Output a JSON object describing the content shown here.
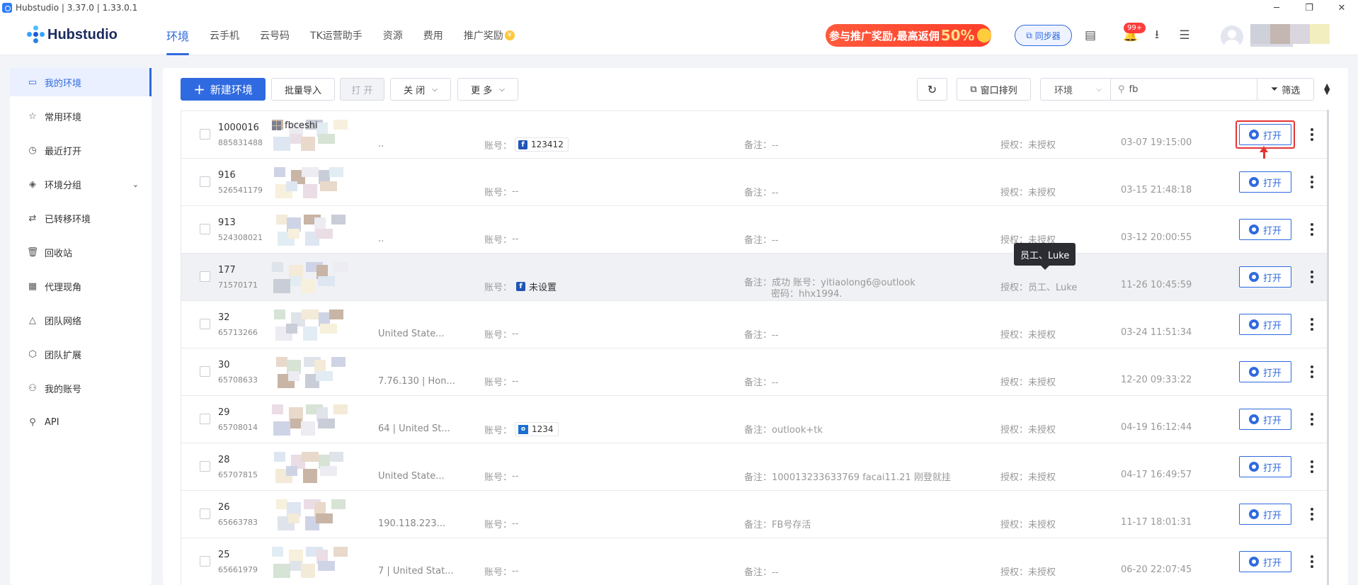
{
  "window": {
    "title": "Hubstudio | 3.37.0 | 1.33.0.1",
    "controls": [
      "─",
      "❐",
      "✕"
    ]
  },
  "header": {
    "brand": "Hubstudio",
    "nav": [
      {
        "label": "环境",
        "active": true
      },
      {
        "label": "云手机"
      },
      {
        "label": "云号码"
      },
      {
        "label": "TK运营助手"
      },
      {
        "label": "资源"
      },
      {
        "label": "费用"
      },
      {
        "label": "推广奖励"
      }
    ],
    "promo_text": "参与推广奖励,最高返佣",
    "promo_percent": "50%",
    "sync_label": "同步器",
    "notification_count": "99+",
    "icons": [
      "sync-window-icon",
      "bell-icon",
      "download-icon",
      "task-list-icon",
      "user-avatar-icon"
    ]
  },
  "sidebar": {
    "items": [
      {
        "label": "我的环境",
        "icon": "monitor-icon",
        "active": true
      },
      {
        "label": "常用环境",
        "icon": "star-icon"
      },
      {
        "label": "最近打开",
        "icon": "clock-icon"
      },
      {
        "label": "环境分组",
        "icon": "layers-icon",
        "expandable": true
      },
      {
        "label": "已转移环境",
        "icon": "transfer-icon"
      },
      {
        "label": "回收站",
        "icon": "trash-icon"
      },
      {
        "label": "代理现角",
        "icon": "proxy-icon"
      },
      {
        "label": "团队网络",
        "icon": "network-icon"
      },
      {
        "label": "团队扩展",
        "icon": "cube-icon"
      },
      {
        "label": "我的账号",
        "icon": "user-icon"
      },
      {
        "label": "API",
        "icon": "api-icon"
      }
    ]
  },
  "toolbar": {
    "new_env": "新建环境",
    "batch_import": "批量导入",
    "open": "打 开",
    "close": "关 闭",
    "more": "更 多",
    "window_arrange": "窗口排列",
    "env_select": "环境",
    "search_value": "fb",
    "filter": "筛选"
  },
  "labels": {
    "account": "账号：",
    "note": "备注：",
    "auth": "授权：",
    "open_btn": "打开"
  },
  "tooltip": "员工、Luke",
  "rows": [
    {
      "num": "1000016",
      "id": "885831488",
      "name": "fbceshi",
      "ip": "..",
      "account": "123412",
      "account_type": "fb",
      "note": "--",
      "auth": "未授权",
      "time": "03-07 19:15:00",
      "highlight": true
    },
    {
      "num": "916",
      "id": "526541179",
      "name": "",
      "ip": "",
      "account": "--",
      "note": "--",
      "auth": "未授权",
      "time": "03-15 21:48:18"
    },
    {
      "num": "913",
      "id": "524308021",
      "name": "",
      "ip": "..",
      "account": "--",
      "note": "--",
      "auth": "未授权",
      "time": "03-12 20:00:55"
    },
    {
      "num": "177",
      "id": "71570171",
      "name": "",
      "ip": "",
      "account": "未设置",
      "account_type": "fb",
      "note": "成功 账号：yitiaolong6@outlook",
      "note2": "密码：hhx1994.",
      "auth": "员工、Luke",
      "time": "11-26 10:45:59",
      "hover": true
    },
    {
      "num": "32",
      "id": "65713266",
      "name": "",
      "ip": "United State...",
      "account": "--",
      "note": "--",
      "auth": "未授权",
      "time": "03-24 11:51:34"
    },
    {
      "num": "30",
      "id": "65708633",
      "name": "",
      "ip": "7.76.130 | Hon...",
      "account": "--",
      "note": "--",
      "auth": "未授权",
      "time": "12-20 09:33:22"
    },
    {
      "num": "29",
      "id": "65708014",
      "name": "",
      "ip": "64 | United St...",
      "account": "1234",
      "account_type": "outlook",
      "note": "outlook+tk",
      "auth": "未授权",
      "time": "04-19 16:12:44"
    },
    {
      "num": "28",
      "id": "65707815",
      "name": "",
      "ip": "United State...",
      "account": "--",
      "note": "100013233633769 facai11.21 刚登就挂",
      "auth": "未授权",
      "time": "04-17 16:49:57"
    },
    {
      "num": "26",
      "id": "65663783",
      "name": "",
      "ip": "190.118.223...",
      "account": "--",
      "note": "FB号存活",
      "auth": "未授权",
      "time": "11-17 18:01:31"
    },
    {
      "num": "25",
      "id": "65661979",
      "name": "",
      "ip": "7 | United Stat...",
      "account": "--",
      "note": "--",
      "auth": "未授权",
      "time": "06-20 22:07:45"
    }
  ]
}
